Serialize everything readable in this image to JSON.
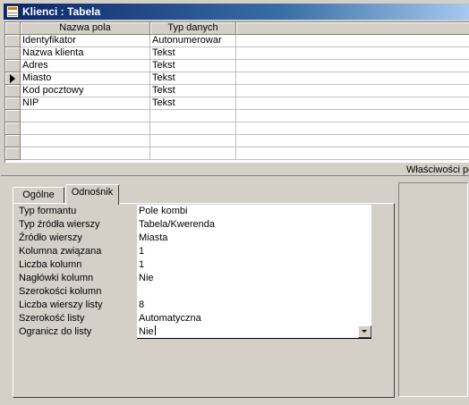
{
  "window": {
    "title": "Klienci : Tabela"
  },
  "grid": {
    "headers": [
      "Nazwa pola",
      "Typ danych",
      ""
    ],
    "rows": [
      {
        "name": "Identyfikator",
        "type": "Autonumerowar",
        "current": false
      },
      {
        "name": "Nazwa klienta",
        "type": "Tekst",
        "current": false
      },
      {
        "name": "Adres",
        "type": "Tekst",
        "current": false
      },
      {
        "name": "Miasto",
        "type": "Tekst",
        "current": true
      },
      {
        "name": "Kod pocztowy",
        "type": "Tekst",
        "current": false
      },
      {
        "name": "NIP",
        "type": "Tekst",
        "current": false
      },
      {
        "name": "",
        "type": "",
        "current": false
      },
      {
        "name": "",
        "type": "",
        "current": false
      },
      {
        "name": "",
        "type": "",
        "current": false
      },
      {
        "name": "",
        "type": "",
        "current": false
      }
    ]
  },
  "field_properties_label": "Właściwości pola",
  "tabs": [
    {
      "label": "Ogólne",
      "active": false
    },
    {
      "label": "Odnośnik",
      "active": true
    }
  ],
  "properties": [
    {
      "label": "Typ formantu",
      "value": "Pole kombi"
    },
    {
      "label": "Typ źródła wierszy",
      "value": "Tabela/Kwerenda"
    },
    {
      "label": "Źródło wierszy",
      "value": "Miasta"
    },
    {
      "label": "Kolumna związana",
      "value": "1"
    },
    {
      "label": "Liczba kolumn",
      "value": "1"
    },
    {
      "label": "Nagłówki kolumn",
      "value": "Nie"
    },
    {
      "label": "Szerokości kolumn",
      "value": ""
    },
    {
      "label": "Liczba wierszy listy",
      "value": "8"
    },
    {
      "label": "Szerokość listy",
      "value": "Automatyczna"
    },
    {
      "label": "Ogranicz do listy",
      "value": "Nie",
      "focused": true
    }
  ]
}
